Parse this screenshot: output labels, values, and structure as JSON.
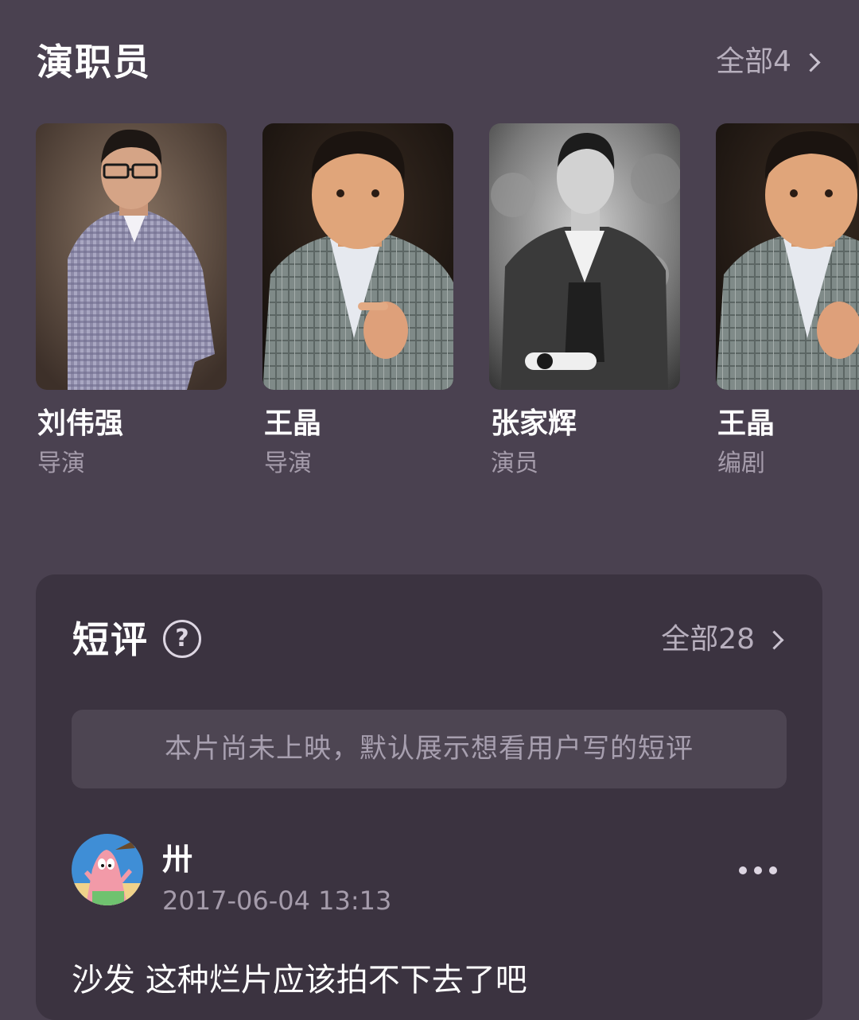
{
  "cast": {
    "title": "演职员",
    "all_label": "全部4",
    "members": [
      {
        "name": "刘伟强",
        "role": "导演"
      },
      {
        "name": "王晶",
        "role": "导演"
      },
      {
        "name": "张家辉",
        "role": "演员"
      },
      {
        "name": "王晶",
        "role": "编剧"
      }
    ]
  },
  "reviews": {
    "title": "短评",
    "all_label": "全部28",
    "notice": "本片尚未上映，默认展示想看用户写的短评",
    "items": [
      {
        "username": "卅",
        "time": "2017-06-04 13:13",
        "text": "沙发 这种烂片应该拍不下去了吧"
      }
    ]
  },
  "colors": {
    "background": "#4a4150",
    "panel": "#3b3340",
    "notice_bg": "#4d4552",
    "secondary_text": "#a59cab"
  }
}
